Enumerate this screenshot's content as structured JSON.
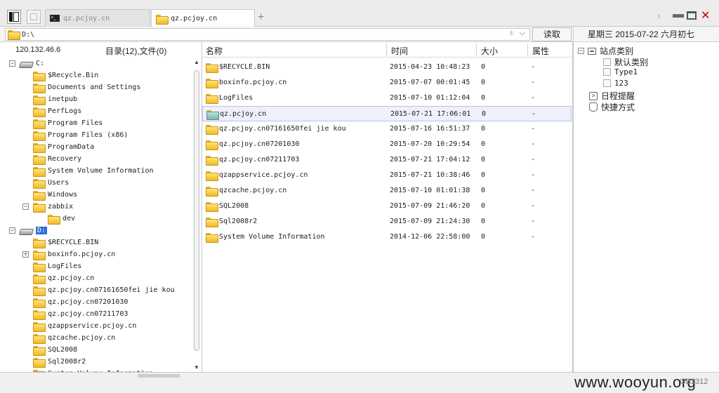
{
  "tabs": [
    {
      "label": "qz.pcjoy.cn",
      "active": false,
      "icon": "terminal-icon"
    },
    {
      "label": "qz.pcjoy.cn",
      "active": true,
      "icon": "folder-icon"
    }
  ],
  "new_tab_label": "+",
  "address": {
    "path": "D:\\",
    "read_button": "读取"
  },
  "date_text": "星期三  2015-07-22  六月初七",
  "left": {
    "server_ip": "120.132.46.6",
    "summary": "目录(12),文件(0)",
    "tree": [
      {
        "label": "C:",
        "type": "drive",
        "expander": "−"
      },
      {
        "label": "$Recycle.Bin",
        "type": "folder"
      },
      {
        "label": "Documents and Settings",
        "type": "folder"
      },
      {
        "label": "inetpub",
        "type": "folder"
      },
      {
        "label": "PerfLogs",
        "type": "folder"
      },
      {
        "label": "Program Files",
        "type": "folder"
      },
      {
        "label": "Program Files (x86)",
        "type": "folder"
      },
      {
        "label": "ProgramData",
        "type": "folder"
      },
      {
        "label": "Recovery",
        "type": "folder"
      },
      {
        "label": "System Volume Information",
        "type": "folder"
      },
      {
        "label": "Users",
        "type": "folder"
      },
      {
        "label": "Windows",
        "type": "folder"
      },
      {
        "label": "zabbix",
        "type": "folder",
        "expander": "−"
      },
      {
        "label": "dev",
        "type": "folder"
      },
      {
        "label": "D:",
        "type": "drive",
        "expander": "−",
        "selected": true
      },
      {
        "label": "$RECYCLE.BIN",
        "type": "folder"
      },
      {
        "label": "boxinfo.pcjoy.cn",
        "type": "folder",
        "expander": "+"
      },
      {
        "label": "LogFiles",
        "type": "folder"
      },
      {
        "label": "qz.pcjoy.cn",
        "type": "folder"
      },
      {
        "label": "qz.pcjoy.cn07161650fei jie kou",
        "type": "folder"
      },
      {
        "label": "qz.pcjoy.cn07201030",
        "type": "folder"
      },
      {
        "label": "qz.pcjoy.cn07211703",
        "type": "folder"
      },
      {
        "label": "qzappservice.pcjoy.cn",
        "type": "folder"
      },
      {
        "label": "qzcache.pcjoy.cn",
        "type": "folder"
      },
      {
        "label": "SQL2008",
        "type": "folder"
      },
      {
        "label": "Sql2008r2",
        "type": "folder"
      },
      {
        "label": "System Volume Information",
        "type": "folder"
      }
    ]
  },
  "files": {
    "columns": {
      "name": "名称",
      "time": "时间",
      "size": "大小",
      "attr": "属性"
    },
    "rows": [
      {
        "name": "$RECYCLE.BIN",
        "time": "2015-04-23 10:48:23",
        "size": "0",
        "attr": "-"
      },
      {
        "name": "boxinfo.pcjoy.cn",
        "time": "2015-07-07 00:01:45",
        "size": "0",
        "attr": "-"
      },
      {
        "name": "LogFiles",
        "time": "2015-07-10 01:12:04",
        "size": "0",
        "attr": "-"
      },
      {
        "name": "qz.pcjoy.cn",
        "time": "2015-07-21 17:06:01",
        "size": "0",
        "attr": "-",
        "selected": true
      },
      {
        "name": "qz.pcjoy.cn07161650fei jie kou",
        "time": "2015-07-16 16:51:37",
        "size": "0",
        "attr": "-"
      },
      {
        "name": "qz.pcjoy.cn07201030",
        "time": "2015-07-20 10:29:54",
        "size": "0",
        "attr": "-"
      },
      {
        "name": "qz.pcjoy.cn07211703",
        "time": "2015-07-21 17:04:12",
        "size": "0",
        "attr": "-"
      },
      {
        "name": "qzappservice.pcjoy.cn",
        "time": "2015-07-21 10:38:46",
        "size": "0",
        "attr": "-"
      },
      {
        "name": "qzcache.pcjoy.cn",
        "time": "2015-07-10 01:01:38",
        "size": "0",
        "attr": "-"
      },
      {
        "name": "SQL2008",
        "time": "2015-07-09 21:46:20",
        "size": "0",
        "attr": "-"
      },
      {
        "name": "Sql2008r2",
        "time": "2015-07-09 21:24:30",
        "size": "0",
        "attr": "-"
      },
      {
        "name": "System Volume Information",
        "time": "2014-12-06 22:58:00",
        "size": "0",
        "attr": "-"
      }
    ]
  },
  "right": {
    "root": "站点类别",
    "children": [
      "默认类别",
      "Type1",
      "123"
    ],
    "schedule": "日程提醒",
    "shortcuts": "快捷方式"
  },
  "status": {
    "watermark": "www.wooyun.org",
    "encoding": "GB2312"
  }
}
